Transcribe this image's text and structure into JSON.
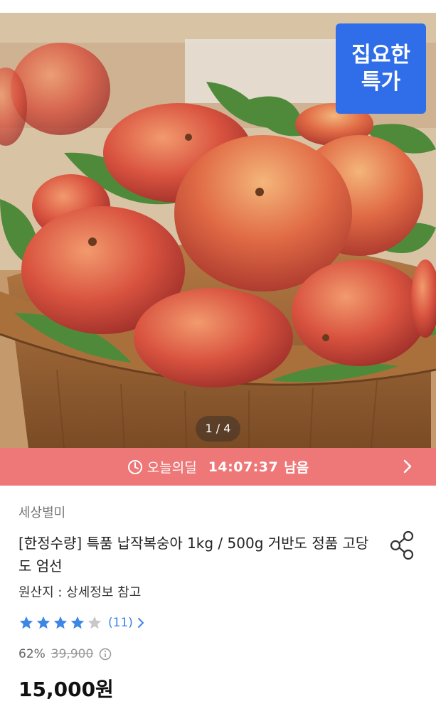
{
  "badge": {
    "line1": "집요한",
    "line2": "특가"
  },
  "pager": {
    "text": "1 / 4"
  },
  "deal": {
    "label": "오늘의딜",
    "time": "14:07:37",
    "remaining": "남음"
  },
  "product": {
    "seller": "세상별미",
    "title": "[한정수량] 특품 납작복숭아 1kg / 500g 거반도 정품 고당도 엄선",
    "origin": "원산지 : 상세정보 참고",
    "rating": {
      "stars": 4,
      "max": 5,
      "count": "(11)"
    },
    "discount": "62%",
    "original_price": "39,900",
    "price": "15,000원"
  },
  "colors": {
    "deal_bar": "#ee7778",
    "badge": "#2f6de9",
    "star": "#3c86e6"
  },
  "icons": [
    "clock-icon",
    "chevron-right-icon",
    "share-icon",
    "star-icon",
    "info-icon"
  ]
}
